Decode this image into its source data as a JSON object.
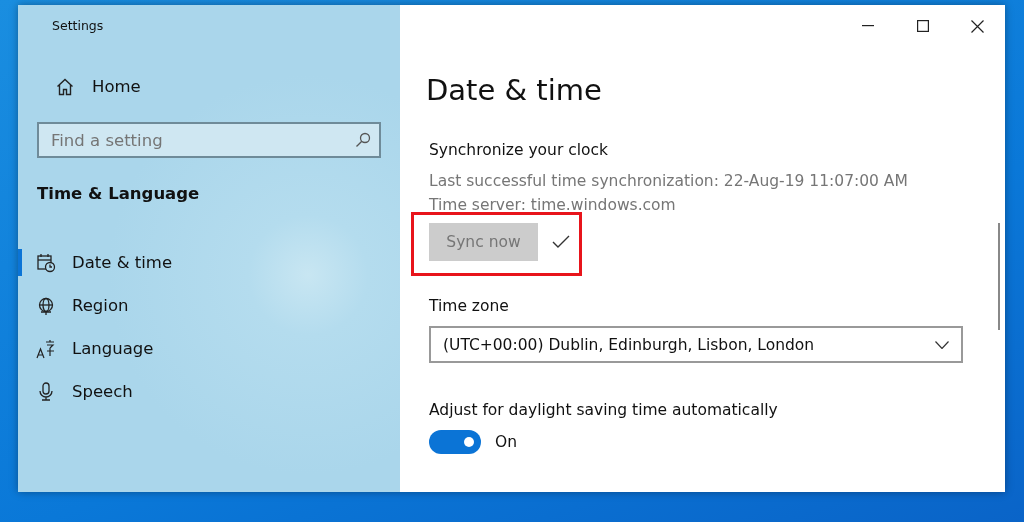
{
  "window": {
    "title": "Settings"
  },
  "sidebar": {
    "home": "Home",
    "search": {
      "placeholder": "Find a setting"
    },
    "section": "Time & Language",
    "items": [
      {
        "label": "Date & time",
        "selected": true
      },
      {
        "label": "Region",
        "selected": false
      },
      {
        "label": "Language",
        "selected": false
      },
      {
        "label": "Speech",
        "selected": false
      }
    ]
  },
  "content": {
    "title": "Date & time",
    "sync": {
      "heading": "Synchronize your clock",
      "lines": [
        "Last successful time synchronization: 22-Aug-19 11:07:00 AM",
        "Time server: time.windows.com"
      ],
      "button": {
        "label": "Sync now",
        "disabled": true
      },
      "succeeded": true,
      "highlighted": true
    },
    "time_zone": {
      "label": "Time zone",
      "value": "(UTC+00:00) Dublin, Edinburgh, Lisbon, London"
    },
    "daylight": {
      "label": "Adjust for daylight saving time automatically",
      "on": true,
      "state": "On"
    }
  }
}
